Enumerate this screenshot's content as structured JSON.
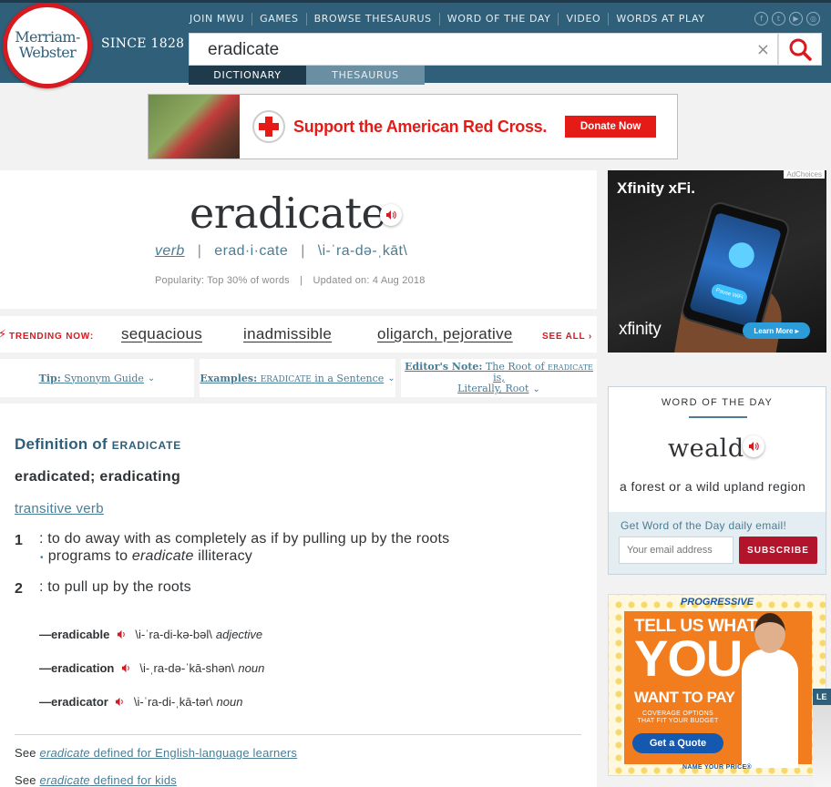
{
  "logo": {
    "line1": "Merriam-",
    "line2": "Webster",
    "since": "SINCE 1828"
  },
  "topnav": [
    "JOIN MWU",
    "GAMES",
    "BROWSE THESAURUS",
    "WORD OF THE DAY",
    "VIDEO",
    "WORDS AT PLAY"
  ],
  "social": [
    {
      "icon": "facebook-icon",
      "glyph": "f"
    },
    {
      "icon": "twitter-icon",
      "glyph": "t"
    },
    {
      "icon": "youtube-icon",
      "glyph": "▶"
    },
    {
      "icon": "instagram-icon",
      "glyph": "◎"
    }
  ],
  "search": {
    "value": "eradicate",
    "clear": "×"
  },
  "tabs": {
    "dictionary": "DICTIONARY",
    "thesaurus": "THESAURUS"
  },
  "banner": {
    "text": "Support the American Red Cross.",
    "button": "Donate Now"
  },
  "entry": {
    "headword": "eradicate",
    "pos": "verb",
    "syllables": "erad·i·cate",
    "pronunciation": "\\i-ˈra-də-ˌkāt\\",
    "popularity": "Popularity: Top 30% of words",
    "updated": "Updated on: 4 Aug 2018"
  },
  "trending": {
    "label": "TRENDING NOW:",
    "links": [
      "sequacious",
      "inadmissible",
      "oligarch, pejorative"
    ],
    "see_all": "SEE ALL"
  },
  "tips": {
    "tip_prefix": "Tip:",
    "tip_text": "Synonym Guide",
    "examples_prefix": "Examples:",
    "examples_word": "ERADICATE",
    "examples_text": "in a Sentence",
    "editor_prefix": "Editor's Note:",
    "editor_text1": "The Root of",
    "editor_word": "ERADICATE",
    "editor_text2": "is,",
    "editor_text3": "Literally, Root"
  },
  "definition": {
    "title": "Definition of",
    "title_word": "ERADICATE",
    "inflections": "eradicated; eradicating",
    "function": "transitive verb",
    "senses": [
      {
        "num": "1",
        "text": ": to do away with as completely as if by pulling up by the roots",
        "ex_pre": "programs to ",
        "ex_word": "eradicate",
        "ex_post": " illiteracy"
      },
      {
        "num": "2",
        "text": ": to pull up by the roots"
      }
    ],
    "runons": [
      {
        "word": "—eradicable",
        "pr": "\\i-ˈra-di-kə-bəl\\",
        "fl": "adjective"
      },
      {
        "word": "—eradication",
        "pr": "\\i-ˌra-də-ˈkā-shən\\",
        "fl": "noun"
      },
      {
        "word": "—eradicator",
        "pr": "\\i-ˈra-di-ˌkā-tər\\",
        "fl": "noun"
      }
    ],
    "see1_pre": "See ",
    "see1_word": "eradicate",
    "see1_post": " defined for English-language learners",
    "see2_pre": "See ",
    "see2_word": "eradicate",
    "see2_post": " defined for kids"
  },
  "ads": {
    "adchoices": "AdChoices",
    "xfinity_title": "Xfinity xFi.",
    "xfinity_logo": "xfinity",
    "xfinity_btn": "Learn More ▸",
    "xfinity_pause": "Pause WiFi",
    "progressive_logo": "PROGRESSIVE",
    "progressive_t1": "TELL US WHAT",
    "progressive_t2": "YOU",
    "progressive_t3": "WANT TO PAY",
    "progressive_t4": "COVERAGE OPTIONS THAT FIT YOUR BUDGET",
    "progressive_btn": "Get a Quote",
    "progressive_name": "NAME YOUR PRICE®",
    "edge_tag": "LE"
  },
  "wotd": {
    "label": "WORD OF THE DAY",
    "word": "weald",
    "definition": "a forest or a wild upland region",
    "email_label": "Get Word of the Day daily email!",
    "email_placeholder": "Your email address",
    "subscribe": "SUBSCRIBE"
  },
  "colors": {
    "brand": "#305f7a",
    "accent_red": "#d71920",
    "link": "#4a7d95",
    "subscribe": "#b2142b"
  }
}
